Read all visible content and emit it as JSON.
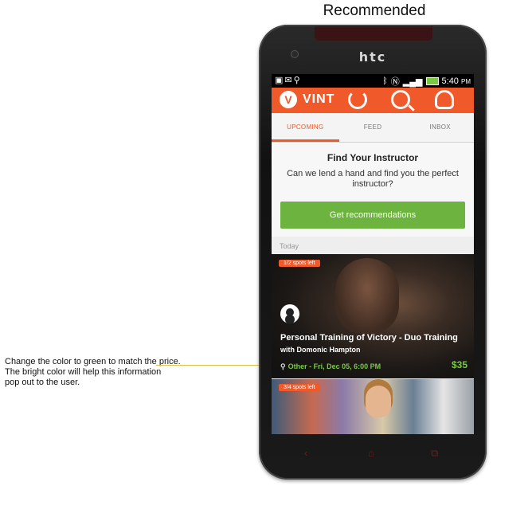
{
  "page": {
    "title": "Recommended"
  },
  "annotation": {
    "lines": [
      "Change the color to green to match the price.",
      "The bright color will help this information",
      "pop out to the user."
    ]
  },
  "device": {
    "brand": "htc"
  },
  "status_bar": {
    "time": "5:40",
    "ampm": "PM"
  },
  "app": {
    "logo_letter": "V",
    "name": "VINT"
  },
  "tabs": [
    {
      "label": "UPCOMING",
      "active": true
    },
    {
      "label": "FEED",
      "active": false
    },
    {
      "label": "INBOX",
      "active": false
    }
  ],
  "recommend_card": {
    "title": "Find Your Instructor",
    "body": "Can we lend a hand and find you the perfect instructor?",
    "button_label": "Get recommendations"
  },
  "section_label": "Today",
  "events": [
    {
      "spots": "1/2 spots left",
      "title": "Personal Training of Victory - Duo Training",
      "host": "with Domonic Hampton",
      "meta": "Other - Fri, Dec 05, 6:00 PM",
      "price": "$35"
    },
    {
      "spots": "3/4 spots left"
    }
  ],
  "colors": {
    "accent": "#f05a2a",
    "cta_green": "#6db33f",
    "price_green": "#7ac943"
  }
}
